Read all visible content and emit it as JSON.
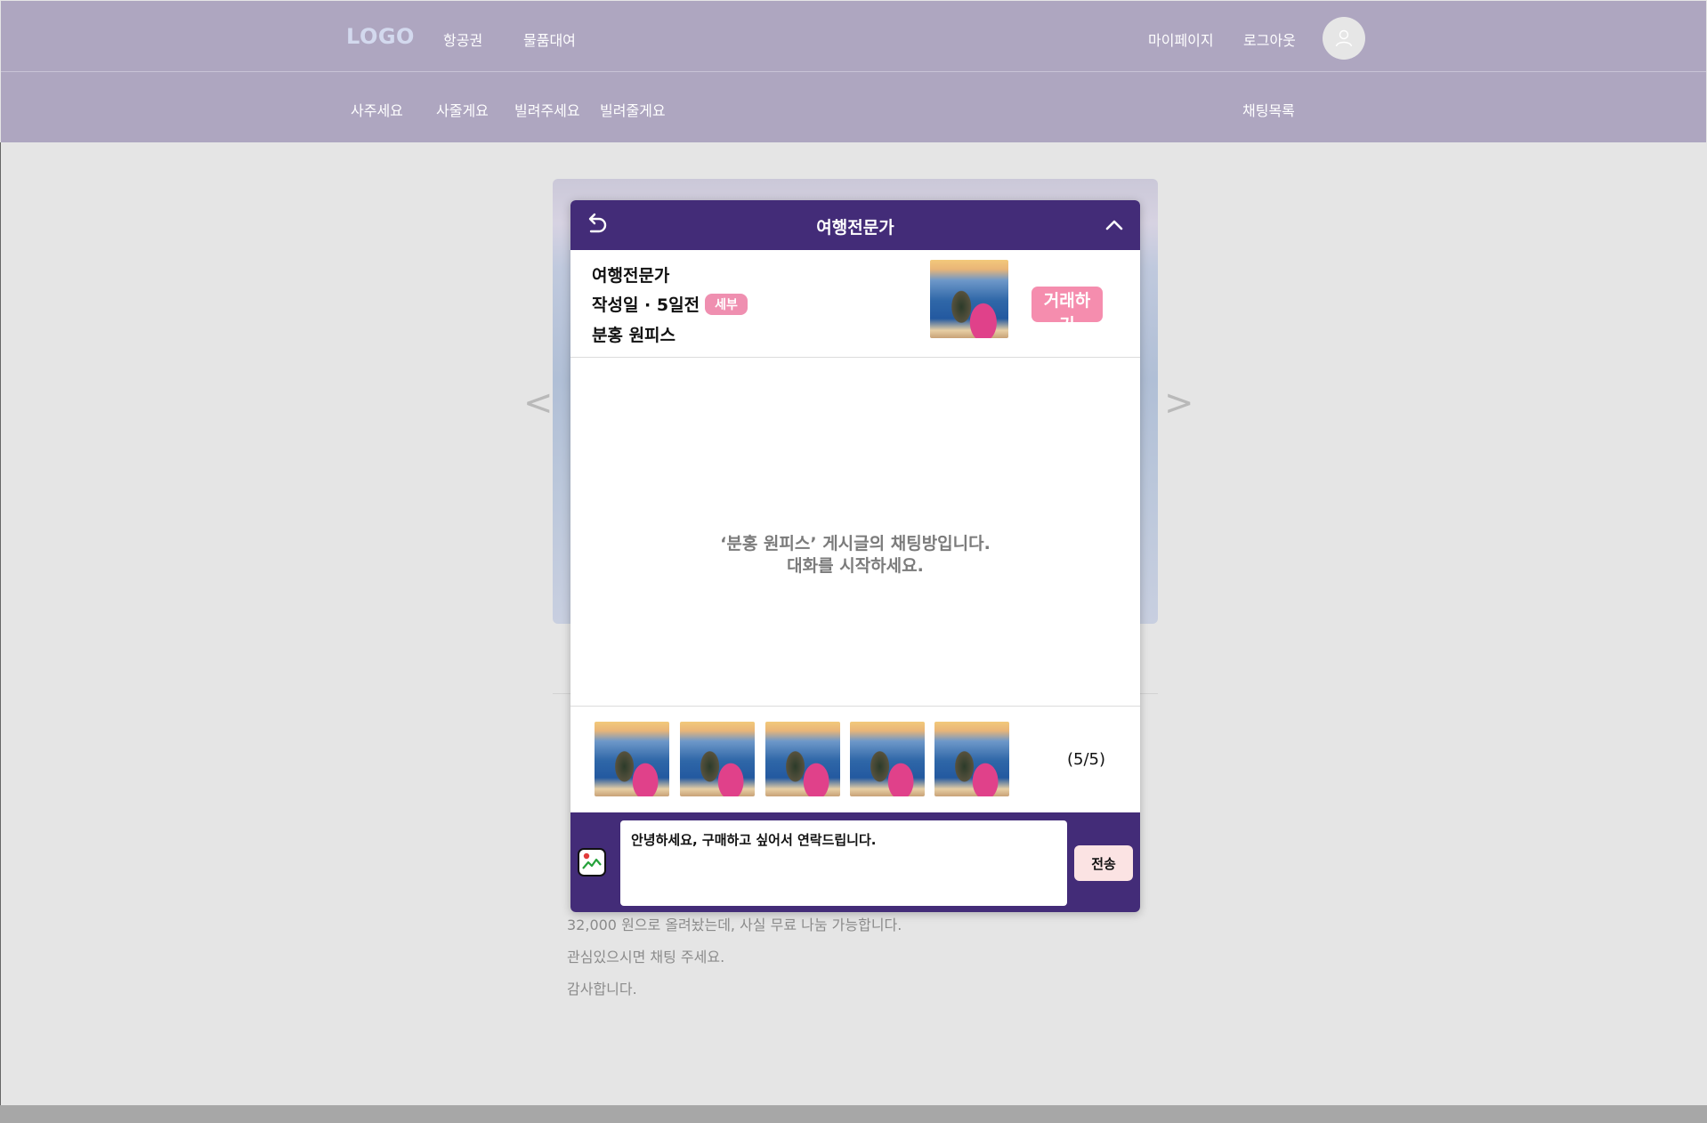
{
  "topnav": {
    "logo": "LOGO",
    "links": [
      "항공권",
      "물품대여"
    ],
    "right_links": [
      "마이페이지",
      "로그아웃"
    ],
    "avatar_icon": "user-icon"
  },
  "subnav": {
    "links": [
      "사주세요",
      "사줄게요",
      "빌려주세요",
      "빌려줄게요"
    ],
    "chat_list": "채팅목록"
  },
  "background_post": {
    "prev_arrow": "<",
    "next_arrow": ">",
    "lines": [
      "32,000 원으로 올려놨는데, 사실 무료 나눔 가능합니다.",
      "관심있으시면 채팅 주세요.",
      "감사합니다."
    ]
  },
  "chat": {
    "title": "여행전문가",
    "back_icon": "undo-arrow-icon",
    "collapse_icon": "chevron-up-icon",
    "seller_name": "여행전문가",
    "date_label": "작성일 · 5일전",
    "badge": "세부",
    "item_title": "분홍 원피스",
    "trade_button": "거래하기",
    "empty_line1": "‘분홍 원피스’ 게시글의 채팅방입니다.",
    "empty_line2": "대화를 시작하세요.",
    "photo_count": "(5/5)",
    "message": "안녕하세요, 구매하고 싶어서 연락드립니다.",
    "image_button_icon": "image-attach-icon",
    "send_button": "전송"
  },
  "colors": {
    "nav_bg": "#aea6c0",
    "chat_header": "#432c78",
    "accent_pink": "#f58dae",
    "send_bg": "#fbe3e3"
  }
}
